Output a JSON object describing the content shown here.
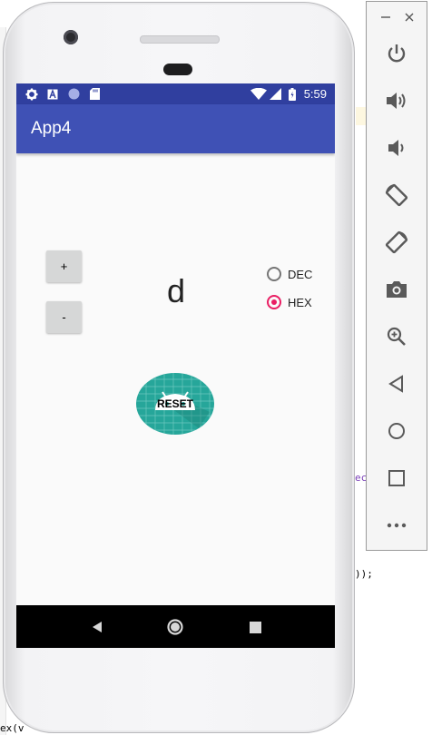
{
  "background_ide": {
    "fragment_1": "ec",
    "fragment_2": "));",
    "fragment_3": "ex(v"
  },
  "device": {
    "status_bar": {
      "time": "5:59",
      "icons": [
        "gear-icon",
        "a-badge-icon",
        "circle-icon",
        "sd-card-icon",
        "wifi-icon",
        "signal-icon",
        "battery-icon"
      ]
    },
    "app_bar": {
      "title": "App4"
    },
    "content": {
      "plus_label": "+",
      "minus_label": "-",
      "display_value": "d",
      "radio_dec_label": "DEC",
      "radio_hex_label": "HEX",
      "selected_radio": "HEX",
      "reset_label": "RESET"
    },
    "nav_bar": {
      "icons": [
        "back-icon",
        "home-icon",
        "recents-icon"
      ]
    }
  },
  "emulator_toolbar": {
    "icons": [
      "minimize-icon",
      "close-icon",
      "power-icon",
      "volume-up-icon",
      "volume-down-icon",
      "rotate-left-icon",
      "rotate-right-icon",
      "camera-icon",
      "zoom-icon",
      "back-icon",
      "home-icon",
      "overview-icon",
      "more-icon"
    ]
  },
  "colors": {
    "status_bar": "#303f9f",
    "app_bar": "#3f51b5",
    "accent": "#e91e63",
    "reset_fab": "#26a69a",
    "toolbar_icon": "#5a5a5a"
  }
}
